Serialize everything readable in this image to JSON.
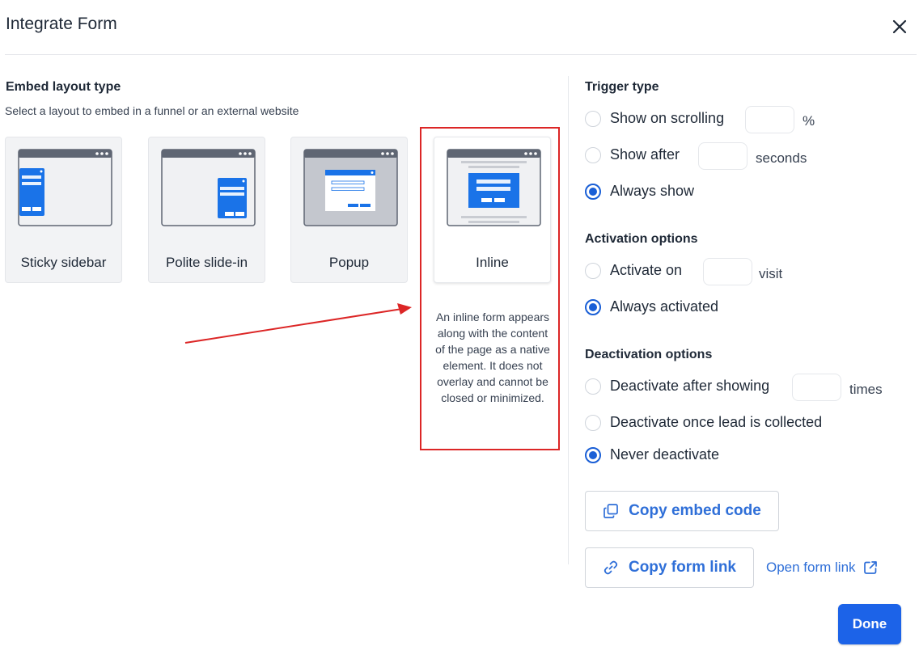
{
  "modal": {
    "title": "Integrate Form"
  },
  "icons": {
    "close": "close-icon",
    "copy": "copy-icon",
    "link": "link-icon",
    "external": "external-link-icon"
  },
  "colors": {
    "accent": "#1c63e8",
    "link": "#2f6fd8",
    "highlight": "#dc2626",
    "thumb_blue": "#1a73e8"
  },
  "embed": {
    "title": "Embed layout type",
    "subtitle": "Select a layout to embed in a funnel or an external website",
    "layouts": [
      {
        "label": "Sticky sidebar",
        "selected": false
      },
      {
        "label": "Polite slide-in",
        "selected": false
      },
      {
        "label": "Popup",
        "selected": false
      },
      {
        "label": "Inline",
        "selected": true
      }
    ],
    "description": "An inline form appears along with the content of the page as a native element. It does not overlay and cannot be closed or minimized."
  },
  "trigger": {
    "title": "Trigger type",
    "options": [
      {
        "label": "Show on scrolling",
        "unit": "%",
        "value": "",
        "selected": false
      },
      {
        "label": "Show after",
        "unit": "seconds",
        "value": "",
        "selected": false
      },
      {
        "label": "Always show",
        "selected": true
      }
    ]
  },
  "activation": {
    "title": "Activation options",
    "options": [
      {
        "label": "Activate on",
        "unit": "visit",
        "value": "",
        "selected": false
      },
      {
        "label": "Always activated",
        "selected": true
      }
    ]
  },
  "deactivation": {
    "title": "Deactivation options",
    "options": [
      {
        "label": "Deactivate after showing",
        "unit": "times",
        "value": "",
        "selected": false
      },
      {
        "label": "Deactivate once lead is collected",
        "selected": false
      },
      {
        "label": "Never deactivate",
        "selected": true
      }
    ]
  },
  "actions": {
    "copy_embed": "Copy embed code",
    "copy_link": "Copy form link",
    "open_link": "Open form link",
    "done": "Done"
  }
}
